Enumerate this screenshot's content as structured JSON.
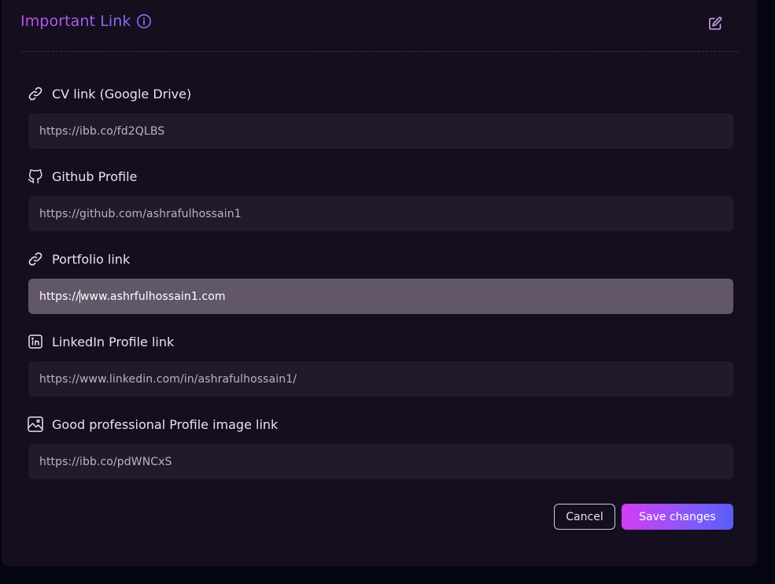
{
  "header": {
    "title": "Important Link",
    "info_icon": "info-icon",
    "edit_icon": "edit-icon"
  },
  "fields": [
    {
      "label": "CV link (Google Drive)",
      "icon": "link-icon",
      "value": "https://ibb.co/fd2QLBS"
    },
    {
      "label": "Github Profile",
      "icon": "github-icon",
      "value": "https://github.com/ashrafulhossain1"
    },
    {
      "label": "Portfolio link",
      "icon": "link-icon",
      "value_before_caret": "https://",
      "value_after_caret": "www.ashrfulhossain1.com",
      "focused": true
    },
    {
      "label": "LinkedIn Profile link",
      "icon": "linkedin-icon",
      "value": "https://www.linkedin.com/in/ashrafulhossain1/"
    },
    {
      "label": "Good professional Profile image link",
      "icon": "image-icon",
      "value": "https://ibb.co/pdWNCxS"
    }
  ],
  "actions": {
    "cancel_label": "Cancel",
    "save_label": "Save changes"
  },
  "colors": {
    "accent_start": "#d23ef2",
    "accent_end": "#5a5cf8",
    "card_bg": "#140e1e",
    "input_bg": "#201a2b",
    "input_focused_bg": "#615769"
  }
}
